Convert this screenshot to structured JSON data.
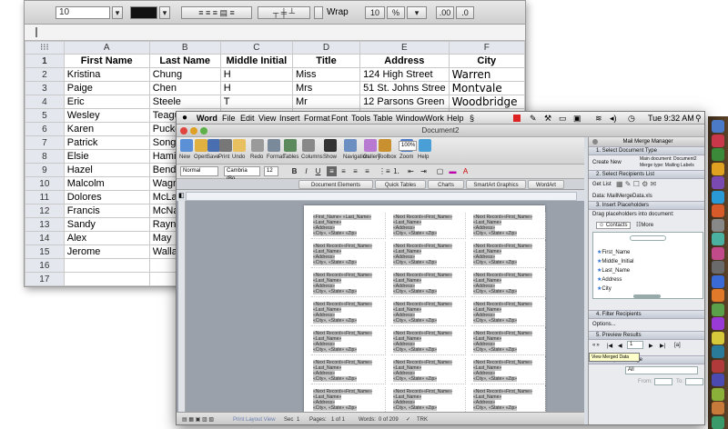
{
  "excel": {
    "font_size": "10",
    "wrap_label": "Wrap",
    "zoom_a": "10",
    "zoom_b": "%",
    "zoom_c": ".00",
    "zoom_d": ".0",
    "columns": [
      "A",
      "B",
      "C",
      "D",
      "E",
      "F"
    ],
    "rows": [
      {
        "n": "1",
        "cells": [
          "First Name",
          "Last Name",
          "Middle Initial",
          "Title",
          "Address",
          "City"
        ]
      },
      {
        "n": "2",
        "cells": [
          "Kristina",
          "Chung",
          "H",
          "Miss",
          "124 High Street",
          "Warren"
        ]
      },
      {
        "n": "3",
        "cells": [
          "Paige",
          "Chen",
          "H",
          "Mrs",
          "51 St. Johns Stree",
          "Montvale"
        ]
      },
      {
        "n": "4",
        "cells": [
          "Eric",
          "Steele",
          "T",
          "Mr",
          "12 Parsons Green",
          "Woodbridge"
        ]
      },
      {
        "n": "5",
        "cells": [
          "Wesley",
          "Teague",
          "",
          "",
          "",
          ""
        ]
      },
      {
        "n": "6",
        "cells": [
          "Karen",
          "Puckett",
          "",
          "",
          "",
          ""
        ]
      },
      {
        "n": "7",
        "cells": [
          "Patrick",
          "Song",
          "",
          "",
          "",
          ""
        ]
      },
      {
        "n": "8",
        "cells": [
          "Elsie",
          "Hamilton",
          "",
          "",
          "",
          ""
        ]
      },
      {
        "n": "9",
        "cells": [
          "Hazel",
          "Bender",
          "",
          "",
          "",
          ""
        ]
      },
      {
        "n": "10",
        "cells": [
          "Malcolm",
          "Wagner",
          "",
          "",
          "",
          ""
        ]
      },
      {
        "n": "11",
        "cells": [
          "Dolores",
          "McLaughl",
          "",
          "",
          "",
          ""
        ]
      },
      {
        "n": "12",
        "cells": [
          "Francis",
          "McNamar",
          "",
          "",
          "",
          ""
        ]
      },
      {
        "n": "13",
        "cells": [
          "Sandy",
          "Raynor",
          "",
          "",
          "",
          ""
        ]
      },
      {
        "n": "14",
        "cells": [
          "Alex",
          "May",
          "",
          "",
          "",
          ""
        ]
      },
      {
        "n": "15",
        "cells": [
          "Jerome",
          "Wallace",
          "",
          "",
          "",
          ""
        ]
      },
      {
        "n": "16",
        "cells": [
          "",
          "",
          "",
          "",
          "",
          ""
        ]
      },
      {
        "n": "17",
        "cells": [
          "",
          "",
          "",
          "",
          "",
          ""
        ]
      },
      {
        "n": "18",
        "cells": [
          "",
          "",
          "",
          "",
          "",
          ""
        ]
      }
    ]
  },
  "word": {
    "menu": [
      "Word",
      "File",
      "Edit",
      "View",
      "Insert",
      "Format",
      "Font",
      "Tools",
      "Table",
      "Window",
      "Work",
      "Help"
    ],
    "clock": "Tue 9:32 AM",
    "doc_title": "Document2",
    "toolbar": [
      "New",
      "Open",
      "Save",
      "Print",
      "Undo",
      "Redo",
      "Format",
      "Tables",
      "Columns",
      "Show",
      "Navigation",
      "Gallery",
      "Toolbox",
      "Zoom",
      "Help"
    ],
    "zoom": "100%",
    "style_box": "Normal",
    "font_box": "Cambria (Bo...",
    "size_box": "12",
    "ribbon_tabs": [
      "Document Elements",
      "Quick Tables",
      "Charts",
      "SmartArt Graphics",
      "WordArt"
    ],
    "label_first": [
      "«First_Name» «Last_Name»",
      "«Last_Name»",
      "«Address»",
      "«City», «State» «Zip»"
    ],
    "label_next": [
      "«Next Record»«First_Name»",
      "«Last_Name»",
      "«Address»",
      "«City», «State» «Zip»"
    ],
    "status": [
      "Print Layout View",
      "Sec",
      "1",
      "Pages:",
      "1 of 1",
      "Words:",
      "0 of 209",
      "TRK"
    ]
  },
  "mmm": {
    "title": "Mail Merge Manager",
    "s1": "1. Select Document Type",
    "create_new": "Create New",
    "main_doc": "Main document: Document2",
    "merge_type": "Merge type: Mailing Labels",
    "s2": "2. Select Recipients List",
    "get_list": "Get List",
    "data_src": "Data: MailMergeData.xls",
    "s3": "3. Insert Placeholders",
    "drag_hint": "Drag placeholders into document:",
    "tab_contacts": "Contacts",
    "tab_more": "More",
    "fields": [
      "First_Name",
      "Middle_Initial",
      "Last_Name",
      "Address",
      "City"
    ],
    "s4": "4. Filter Recipients",
    "options": "Options...",
    "s5": "5. Preview Results",
    "record": "1",
    "abc": "[a]",
    "tooltip": "View Merged Data",
    "s6": "6. Complete Merge",
    "all": "All",
    "from": "From:",
    "to": "To:"
  },
  "colors": {
    "accent": "#2f6fd6",
    "field_highlight": "#c6c6c6"
  }
}
